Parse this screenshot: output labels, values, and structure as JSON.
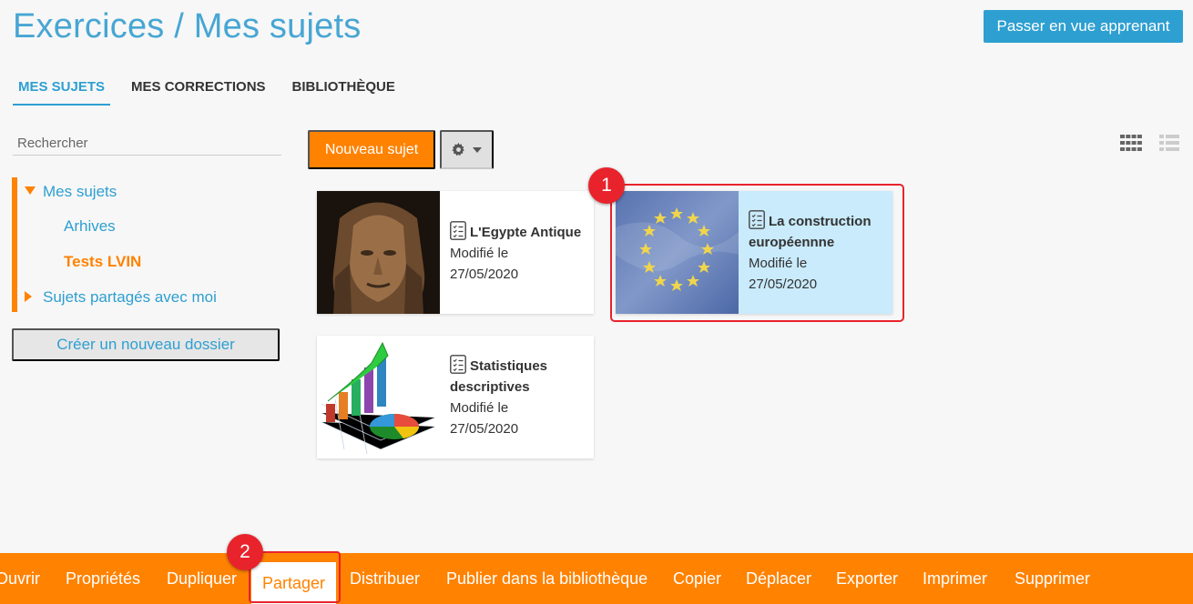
{
  "header": {
    "title": "Exercices / Mes sujets",
    "learner_view_button": "Passer en vue apprenant"
  },
  "tabs": [
    {
      "label": "MES SUJETS",
      "active": true
    },
    {
      "label": "MES CORRECTIONS",
      "active": false
    },
    {
      "label": "BIBLIOTHÈQUE",
      "active": false
    }
  ],
  "sidebar": {
    "search_placeholder": "Rechercher",
    "tree": [
      {
        "label": "Mes sujets",
        "expanded": true
      },
      {
        "label": "Arhives"
      },
      {
        "label": "Tests LVIN",
        "selected": true
      },
      {
        "label": "Sujets partagés avec moi",
        "expanded": false
      }
    ],
    "new_folder_button": "Créer un nouveau dossier"
  },
  "toolbar": {
    "new_subject_button": "Nouveau sujet",
    "settings_icon": "gear-icon",
    "view_grid_icon": "grid-view-icon",
    "view_list_icon": "list-view-icon"
  },
  "cards": [
    {
      "title": "L'Egypte Antique",
      "modified_label": "Modifié le",
      "date": "27/05/2020",
      "thumbnail": "pharaoh-statue",
      "selected": false
    },
    {
      "title": "La construction européennne",
      "modified_label": "Modifié le",
      "date": "27/05/2020",
      "thumbnail": "eu-flag",
      "selected": true
    },
    {
      "title": "Statistiques descriptives",
      "modified_label": "Modifié le",
      "date": "27/05/2020",
      "thumbnail": "statistics-charts",
      "selected": false
    }
  ],
  "annotations": {
    "badge1": "1",
    "badge2": "2"
  },
  "bottom_bar": {
    "items": [
      "Ouvrir",
      "Propriétés",
      "Dupliquer",
      "Partager",
      "Distribuer",
      "Publier dans la bibliothèque",
      "Copier",
      "Déplacer",
      "Exporter",
      "Imprimer",
      "Supprimer"
    ],
    "active": "Partager"
  },
  "colors": {
    "accent_blue": "#2e9fd1",
    "accent_orange": "#ff8200",
    "highlight_red": "#e8232c",
    "selected_card": "#c9ebfb"
  }
}
